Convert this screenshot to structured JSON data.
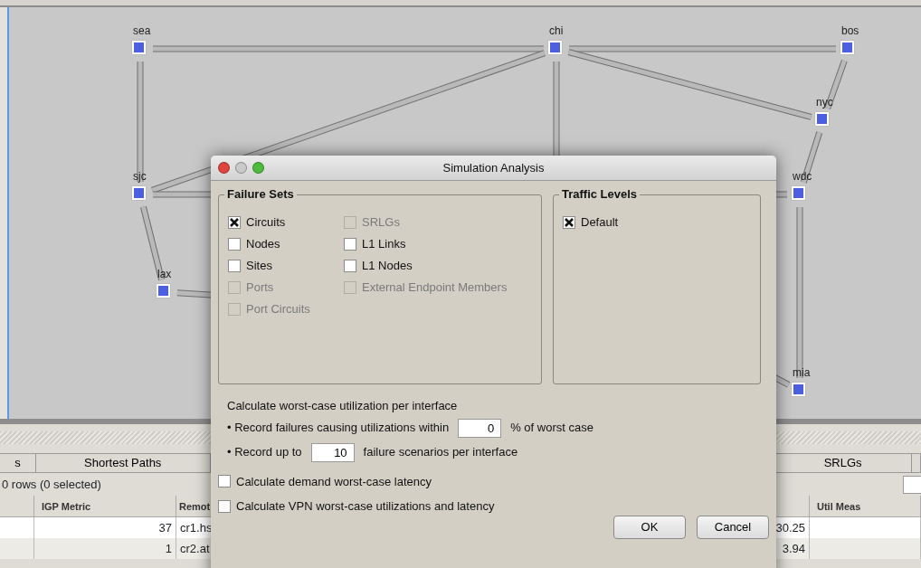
{
  "map": {
    "nodes": [
      {
        "label": "sea"
      },
      {
        "label": "chi"
      },
      {
        "label": "bos"
      },
      {
        "label": "nyc"
      },
      {
        "label": "sjc"
      },
      {
        "label": "wdc"
      },
      {
        "label": "lax"
      },
      {
        "label": "mia"
      }
    ]
  },
  "bottom_panel": {
    "tabs": [
      {
        "label": "s"
      },
      {
        "label": "Shortest Paths"
      },
      {
        "label": "SRLGs"
      }
    ],
    "row_count": "0 rows (0 selected)",
    "table": {
      "columns": [
        "",
        "IGP Metric",
        "Remot",
        "",
        "",
        "Util Meas"
      ],
      "rows": [
        {
          "cells": [
            "",
            "37",
            "cr1.hs",
            "",
            "30.25",
            ""
          ]
        },
        {
          "cells": [
            "",
            "1",
            "cr2.at",
            "",
            "3.94",
            ""
          ]
        }
      ]
    }
  },
  "dialog": {
    "title": "Simulation Analysis",
    "failure_sets": {
      "title": "Failure Sets",
      "items": [
        {
          "label": "Circuits",
          "checked": true,
          "disabled": false
        },
        {
          "label": "Nodes",
          "checked": false,
          "disabled": false
        },
        {
          "label": "Sites",
          "checked": false,
          "disabled": false
        },
        {
          "label": "Ports",
          "checked": false,
          "disabled": true
        },
        {
          "label": "Port Circuits",
          "checked": false,
          "disabled": true
        },
        {
          "label": "SRLGs",
          "checked": false,
          "disabled": true
        },
        {
          "label": "L1 Links",
          "checked": false,
          "disabled": false
        },
        {
          "label": "L1 Nodes",
          "checked": false,
          "disabled": false
        },
        {
          "label": "External Endpoint Members",
          "checked": false,
          "disabled": true
        }
      ]
    },
    "traffic_levels": {
      "title": "Traffic Levels",
      "items": [
        {
          "label": "Default",
          "checked": true,
          "disabled": false
        }
      ]
    },
    "worst_case_heading": "Calculate worst-case utilization per interface",
    "record_lines": [
      {
        "before": "• Record failures causing utilizations within",
        "value": "0",
        "after": "% of worst case"
      },
      {
        "before": "• Record up to",
        "value": "10",
        "after": "failure scenarios per interface"
      }
    ],
    "options": [
      {
        "label": "Calculate demand worst-case latency",
        "checked": false,
        "disabled": false
      },
      {
        "label": "Calculate VPN worst-case utilizations and latency",
        "checked": false,
        "disabled": false
      }
    ],
    "buttons": [
      "OK",
      "Cancel"
    ]
  }
}
